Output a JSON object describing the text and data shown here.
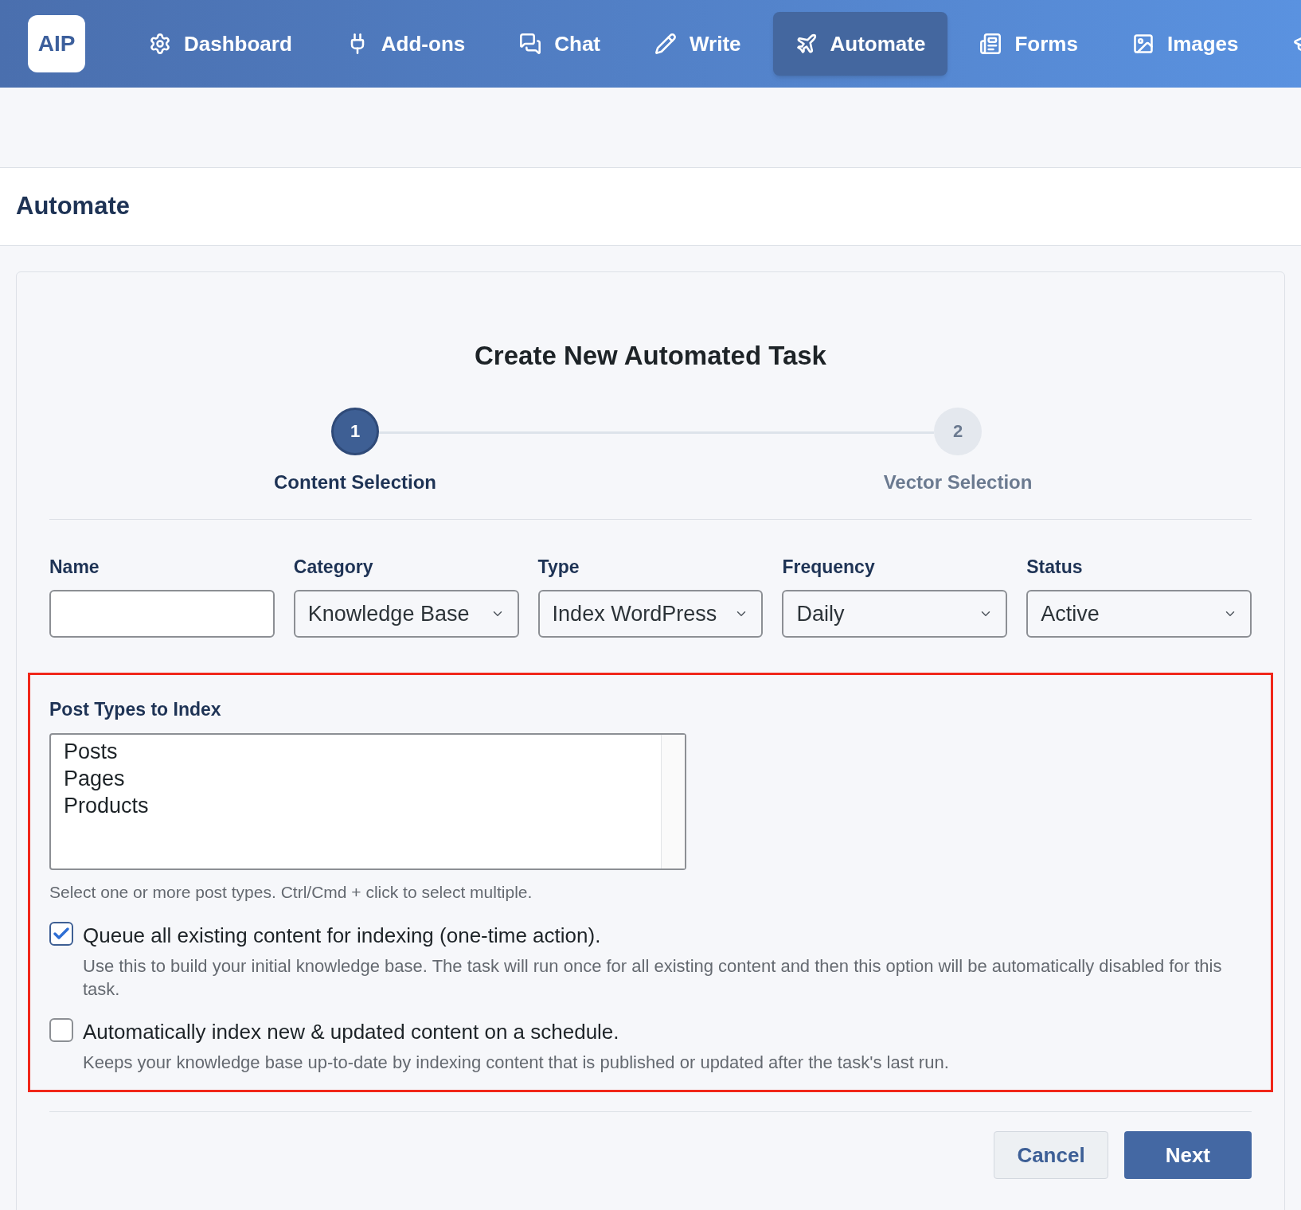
{
  "logo": "AIP",
  "nav": [
    {
      "label": "Dashboard",
      "kind": "gear",
      "selected": false
    },
    {
      "label": "Add-ons",
      "kind": "plug",
      "selected": false
    },
    {
      "label": "Chat",
      "kind": "chat",
      "selected": false
    },
    {
      "label": "Write",
      "kind": "pencil",
      "selected": false
    },
    {
      "label": "Automate",
      "kind": "plane",
      "selected": true
    },
    {
      "label": "Forms",
      "kind": "form",
      "selected": false
    },
    {
      "label": "Images",
      "kind": "image",
      "selected": false
    },
    {
      "kind": "cap",
      "selected": false
    }
  ],
  "page_title": "Automate",
  "card": {
    "title": "Create New Automated Task",
    "steps": [
      {
        "number": "1",
        "label": "Content Selection",
        "selected": true
      },
      {
        "number": "2",
        "label": "Vector Selection",
        "selected": false
      }
    ],
    "fields": [
      {
        "label": "Name",
        "kind": "text"
      },
      {
        "label": "Category",
        "kind": "select",
        "value": "Knowledge Base"
      },
      {
        "label": "Type",
        "kind": "select",
        "value": "Index WordPress"
      },
      {
        "label": "Frequency",
        "kind": "select",
        "value": "Daily"
      },
      {
        "label": "Status",
        "kind": "select",
        "value": "Active"
      }
    ],
    "post_types": {
      "label": "Post Types to Index",
      "options": [
        "Posts",
        "Pages",
        "Products"
      ],
      "help": "Select one or more post types. Ctrl/Cmd + click to select multiple."
    },
    "options": [
      {
        "label": "Queue all existing content for indexing (one-time action).",
        "description": "Use this to build your initial knowledge base. The task will run once for all existing content and then this option will be automatically disabled for this task.",
        "checked": true
      },
      {
        "label": "Automatically index new & updated content on a schedule.",
        "description": "Keeps your knowledge base up-to-date by indexing content that is published or updated after the task's last run.",
        "checked": false
      }
    ],
    "buttons": [
      {
        "label": "Cancel",
        "kind": "secondary"
      },
      {
        "label": "Next",
        "kind": "primary"
      }
    ]
  }
}
